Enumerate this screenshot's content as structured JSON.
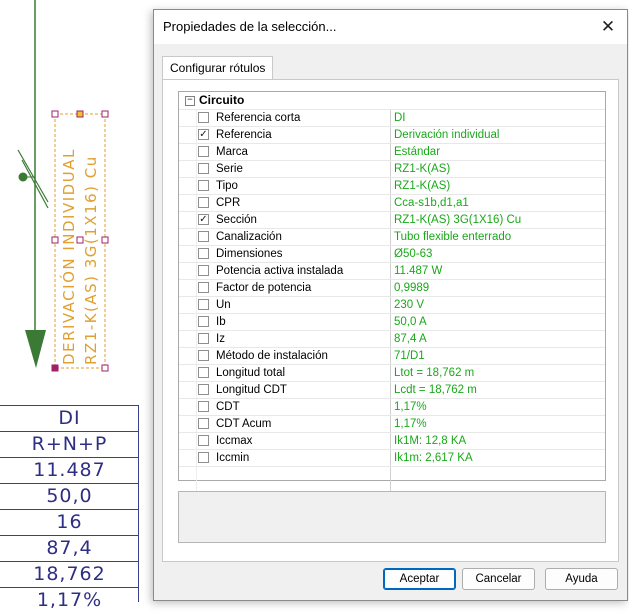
{
  "cad": {
    "label_line1": "DERIVACIÓN INDIVIDUAL",
    "label_line2": "RZ1-K(AS) 3G(1X16) Cu",
    "table_values": [
      "DI",
      "R+N+P",
      "11.487",
      "50,0",
      "16",
      "87,4",
      "18,762",
      "1,17%"
    ],
    "line_color": "#3a7a35",
    "label_color": "#e0a030",
    "table_color": "#2e2f84"
  },
  "dialog": {
    "title": "Propiedades de la selección...",
    "close_glyph": "✕",
    "tab_label": "Configurar rótulos",
    "category": {
      "expander_glyph": "−",
      "label": "Circuito"
    },
    "properties": [
      {
        "name": "Referencia corta",
        "value": "DI",
        "checked": false
      },
      {
        "name": "Referencia",
        "value": "Derivación individual",
        "checked": true
      },
      {
        "name": "Marca",
        "value": "Estándar",
        "checked": false
      },
      {
        "name": "Serie",
        "value": "RZ1-K(AS)",
        "checked": false
      },
      {
        "name": "Tipo",
        "value": "RZ1-K(AS)",
        "checked": false
      },
      {
        "name": "CPR",
        "value": "Cca-s1b,d1,a1",
        "checked": false
      },
      {
        "name": "Sección",
        "value": "RZ1-K(AS) 3G(1X16) Cu",
        "checked": true
      },
      {
        "name": "Canalización",
        "value": "Tubo flexible enterrado",
        "checked": false
      },
      {
        "name": "Dimensiones",
        "value": "Ø50-63",
        "checked": false
      },
      {
        "name": "Potencia activa instalada",
        "value": "11.487 W",
        "checked": false
      },
      {
        "name": "Factor de potencia",
        "value": "0,9989",
        "checked": false
      },
      {
        "name": "Un",
        "value": "230 V",
        "checked": false
      },
      {
        "name": "Ib",
        "value": "50,0 A",
        "checked": false
      },
      {
        "name": "Iz",
        "value": "87,4 A",
        "checked": false
      },
      {
        "name": "Método de instalación",
        "value": "71/D1",
        "checked": false
      },
      {
        "name": "Longitud total",
        "value": "Ltot = 18,762 m",
        "checked": false
      },
      {
        "name": "Longitud CDT",
        "value": "Lcdt = 18,762 m",
        "checked": false
      },
      {
        "name": "CDT",
        "value": "1,17%",
        "checked": false
      },
      {
        "name": "CDT Acum",
        "value": "1,17%",
        "checked": false
      },
      {
        "name": "Iccmax",
        "value": "Ik1M: 12,8 KA",
        "checked": false
      },
      {
        "name": "Iccmin",
        "value": "Ik1m: 2,617 KA",
        "checked": false
      }
    ],
    "value_color": "#1aa81a",
    "buttons": {
      "accept": "Aceptar",
      "cancel": "Cancelar",
      "help": "Ayuda"
    }
  }
}
